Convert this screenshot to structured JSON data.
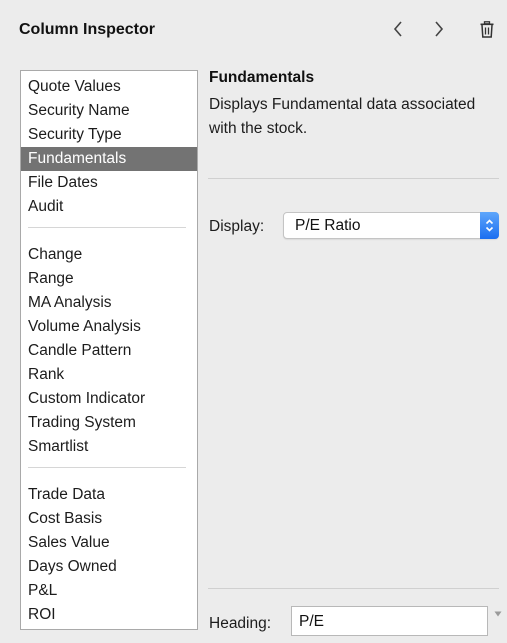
{
  "header": {
    "title": "Column Inspector",
    "back_icon": "chevron-left-icon",
    "forward_icon": "chevron-right-icon",
    "delete_icon": "trash-icon"
  },
  "sidebar": {
    "groups": [
      [
        "Quote Values",
        "Security Name",
        "Security Type",
        "Fundamentals",
        "File Dates",
        "Audit"
      ],
      [
        "Change",
        "Range",
        "MA Analysis",
        "Volume Analysis",
        "Candle Pattern",
        "Rank",
        "Custom Indicator",
        "Trading System",
        "Smartlist"
      ],
      [
        "Trade Data",
        "Cost Basis",
        "Sales Value",
        "Days Owned",
        "P&L",
        "ROI"
      ]
    ],
    "selected": "Fundamentals"
  },
  "detail": {
    "title": "Fundamentals",
    "description": "Displays Fundamental data associated with the stock.",
    "display_label": "Display:",
    "display_value": "P/E Ratio",
    "heading_label": "Heading:",
    "heading_value": "P/E"
  },
  "colors": {
    "selected_bg": "#737373",
    "accent": "#2d7ff5"
  }
}
